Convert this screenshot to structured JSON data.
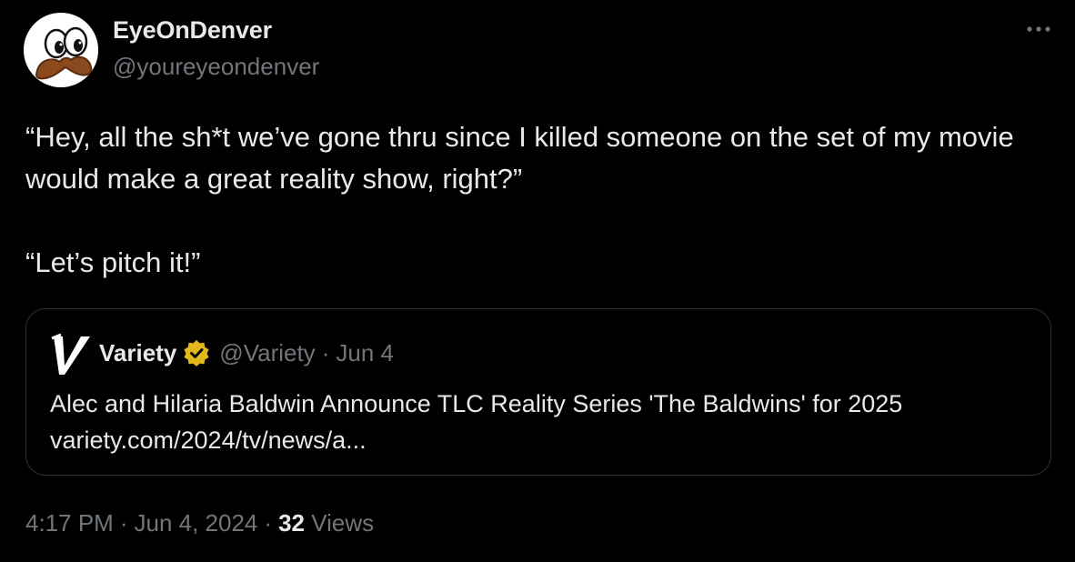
{
  "author": {
    "display_name": "EyeOnDenver",
    "handle": "@youreyeondenver",
    "avatar_icon": "cartoon-eyes-mustache-avatar"
  },
  "more_icon": "more-horizontal-icon",
  "tweet": {
    "paragraphs": [
      "“Hey, all the sh*t we’ve gone thru since I killed someone on the set of my movie would make a great reality show, right?”",
      "“Let’s pitch it!”"
    ]
  },
  "quote": {
    "logo_icon": "variety-v-logo",
    "name": "Variety",
    "verified_icon": "verified-gold-badge-icon",
    "verified_color": "#e2b719",
    "handle": "@Variety",
    "separator": "·",
    "date": "Jun 4",
    "title": "Alec and Hilaria Baldwin Announce TLC Reality Series 'The Baldwins' for 2025",
    "link": "variety.com/2024/tv/news/a..."
  },
  "meta": {
    "time": "4:17 PM",
    "separator": "·",
    "date": "Jun 4, 2024",
    "views_count": "32",
    "views_label": "Views"
  },
  "colors": {
    "background": "#000000",
    "primary_text": "#e7e9ea",
    "secondary_text": "#71767b",
    "border": "#2f3336"
  }
}
